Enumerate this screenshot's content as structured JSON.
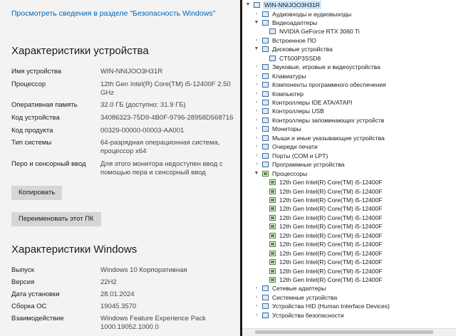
{
  "about": {
    "security_link": "Просмотреть сведения в разделе \"Безопасность Windows\"",
    "device_specs_title": "Характеристики устройства",
    "device_specs": [
      {
        "key": "Имя устройства",
        "value": "WIN-NNIJOO3H31R"
      },
      {
        "key": "Процессор",
        "value": "12th Gen Intel(R) Core(TM) i5-12400F   2.50 GHz"
      },
      {
        "key": "Оперативная память",
        "value": "32.0 ГБ (доступно: 31.9 ГБ)"
      },
      {
        "key": "Код устройства",
        "value": "34086323-75D9-4B0F-9796-28958D568716"
      },
      {
        "key": "Код продукта",
        "value": "00329-00000-00003-AA001"
      },
      {
        "key": "Тип системы",
        "value": "64-разрядная операционная система, процессор x64"
      },
      {
        "key": "Перо и сенсорный ввод",
        "value": "Для этого монитора недоступен ввод с помощью пера и сенсорный ввод"
      }
    ],
    "copy_button": "Копировать",
    "rename_button": "Переименовать этот ПК",
    "windows_specs_title": "Характеристики Windows",
    "windows_specs": [
      {
        "key": "Выпуск",
        "value": "Windows 10 Корпоративная"
      },
      {
        "key": "Версия",
        "value": "22H2"
      },
      {
        "key": "Дата установки",
        "value": "28.01.2024"
      },
      {
        "key": "Сборка ОС",
        "value": "19045.3570"
      },
      {
        "key": "Взаимодействие",
        "value": "Windows Feature Experience Pack 1000.19052.1000.0"
      }
    ]
  },
  "device_manager": {
    "root": "WIN-NNIJOO3H31R",
    "nodes": [
      {
        "label": "Аудиовходы и аудиовыходы",
        "level": 1,
        "state": "collapsed",
        "icon": "audio-icon"
      },
      {
        "label": "Видеоадаптеры",
        "level": 1,
        "state": "expanded",
        "icon": "display-adapter-icon"
      },
      {
        "label": "NVIDIA GeForce RTX 3060 Ti",
        "level": 2,
        "state": "leaf",
        "icon": "display-adapter-icon"
      },
      {
        "label": "Встроенное ПО",
        "level": 1,
        "state": "collapsed",
        "icon": "firmware-icon"
      },
      {
        "label": "Дисковые устройства",
        "level": 1,
        "state": "expanded",
        "icon": "disk-icon"
      },
      {
        "label": "CT500P3SSD8",
        "level": 2,
        "state": "leaf",
        "icon": "disk-icon"
      },
      {
        "label": "Звуковые, игровые и видеоустройства",
        "level": 1,
        "state": "collapsed",
        "icon": "sound-icon"
      },
      {
        "label": "Клавиатуры",
        "level": 1,
        "state": "collapsed",
        "icon": "keyboard-icon"
      },
      {
        "label": "Компоненты программного обеспечения",
        "level": 1,
        "state": "collapsed",
        "icon": "software-icon"
      },
      {
        "label": "Компьютер",
        "level": 1,
        "state": "collapsed",
        "icon": "computer-icon"
      },
      {
        "label": "Контроллеры IDE ATA/ATAPI",
        "level": 1,
        "state": "collapsed",
        "icon": "ide-icon"
      },
      {
        "label": "Контроллеры USB",
        "level": 1,
        "state": "collapsed",
        "icon": "usb-icon"
      },
      {
        "label": "Контроллеры запоминающих устройств",
        "level": 1,
        "state": "collapsed",
        "icon": "storage-icon"
      },
      {
        "label": "Мониторы",
        "level": 1,
        "state": "collapsed",
        "icon": "monitor-icon"
      },
      {
        "label": "Мыши и иные указывающие устройства",
        "level": 1,
        "state": "collapsed",
        "icon": "mouse-icon"
      },
      {
        "label": "Очереди печати",
        "level": 1,
        "state": "collapsed",
        "icon": "printer-icon"
      },
      {
        "label": "Порты (COM и LPT)",
        "level": 1,
        "state": "collapsed",
        "icon": "port-icon"
      },
      {
        "label": "Программные устройства",
        "level": 1,
        "state": "collapsed",
        "icon": "software-device-icon"
      },
      {
        "label": "Процессоры",
        "level": 1,
        "state": "expanded",
        "icon": "cpu-icon"
      },
      {
        "label": "12th Gen Intel(R) Core(TM) i5-12400F",
        "level": 2,
        "state": "leaf",
        "icon": "cpu-icon"
      },
      {
        "label": "12th Gen Intel(R) Core(TM) i5-12400F",
        "level": 2,
        "state": "leaf",
        "icon": "cpu-icon"
      },
      {
        "label": "12th Gen Intel(R) Core(TM) i5-12400F",
        "level": 2,
        "state": "leaf",
        "icon": "cpu-icon"
      },
      {
        "label": "12th Gen Intel(R) Core(TM) i5-12400F",
        "level": 2,
        "state": "leaf",
        "icon": "cpu-icon"
      },
      {
        "label": "12th Gen Intel(R) Core(TM) i5-12400F",
        "level": 2,
        "state": "leaf",
        "icon": "cpu-icon"
      },
      {
        "label": "12th Gen Intel(R) Core(TM) i5-12400F",
        "level": 2,
        "state": "leaf",
        "icon": "cpu-icon"
      },
      {
        "label": "12th Gen Intel(R) Core(TM) i5-12400F",
        "level": 2,
        "state": "leaf",
        "icon": "cpu-icon"
      },
      {
        "label": "12th Gen Intel(R) Core(TM) i5-12400F",
        "level": 2,
        "state": "leaf",
        "icon": "cpu-icon"
      },
      {
        "label": "12th Gen Intel(R) Core(TM) i5-12400F",
        "level": 2,
        "state": "leaf",
        "icon": "cpu-icon"
      },
      {
        "label": "12th Gen Intel(R) Core(TM) i5-12400F",
        "level": 2,
        "state": "leaf",
        "icon": "cpu-icon"
      },
      {
        "label": "12th Gen Intel(R) Core(TM) i5-12400F",
        "level": 2,
        "state": "leaf",
        "icon": "cpu-icon"
      },
      {
        "label": "12th Gen Intel(R) Core(TM) i5-12400F",
        "level": 2,
        "state": "leaf",
        "icon": "cpu-icon"
      },
      {
        "label": "Сетевые адаптеры",
        "level": 1,
        "state": "collapsed",
        "icon": "network-icon"
      },
      {
        "label": "Системные устройства",
        "level": 1,
        "state": "collapsed",
        "icon": "system-icon"
      },
      {
        "label": "Устройства HID (Human Interface Devices)",
        "level": 1,
        "state": "collapsed",
        "icon": "hid-icon"
      },
      {
        "label": "Устройства безопасности",
        "level": 1,
        "state": "collapsed",
        "icon": "security-icon"
      }
    ]
  },
  "colors": {
    "link": "#0063b1",
    "selection": "#cce8ff",
    "button": "#d6d6d6"
  }
}
